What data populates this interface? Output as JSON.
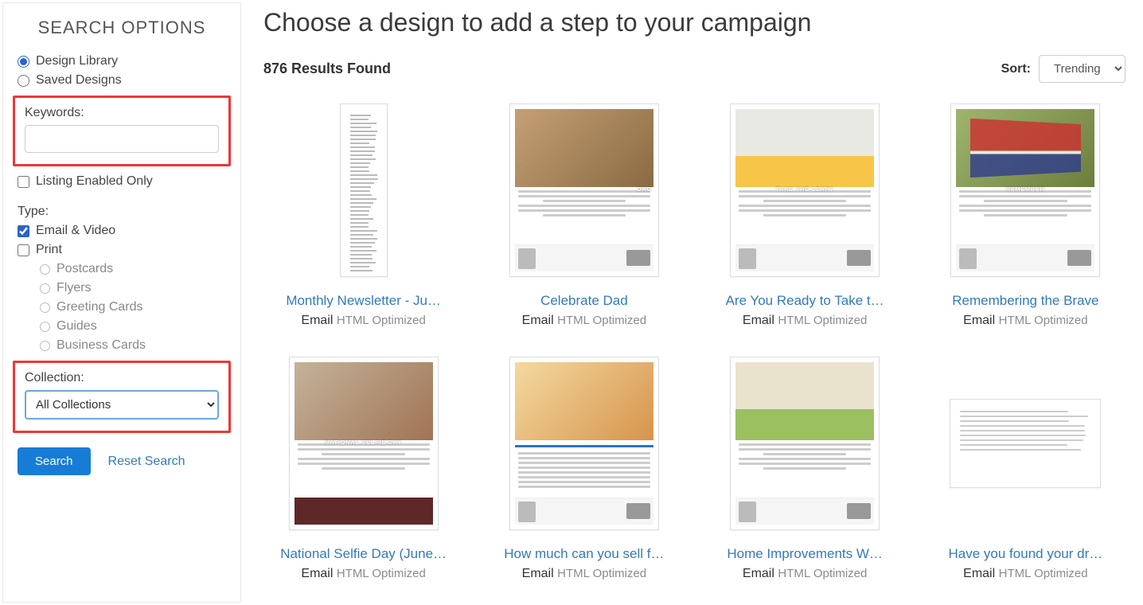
{
  "sidebar": {
    "title": "SEARCH OPTIONS",
    "source_design_library": "Design Library",
    "source_saved_designs": "Saved Designs",
    "keywords_label": "Keywords:",
    "keywords_value": "",
    "listing_enabled_label": "Listing Enabled Only",
    "type_label": "Type:",
    "type_email_video": "Email & Video",
    "type_print": "Print",
    "print_sub": {
      "postcards": "Postcards",
      "flyers": "Flyers",
      "greeting_cards": "Greeting Cards",
      "guides": "Guides",
      "business_cards": "Business Cards"
    },
    "collection_label": "Collection:",
    "collection_value": "All Collections",
    "search_btn": "Search",
    "reset_btn": "Reset Search"
  },
  "main": {
    "title": "Choose a design to add a step to your campaign",
    "results_count": "876 Results Found",
    "sort_label": "Sort:",
    "sort_value": "Trending"
  },
  "cards": [
    {
      "title": "Monthly Newsletter - Ju…",
      "medium": "Email",
      "subtype": "HTML Optimized",
      "thumbStyle": "narrow"
    },
    {
      "title": "Celebrate Dad",
      "medium": "Email",
      "subtype": "HTML Optimized",
      "thumbStyle": "dad"
    },
    {
      "title": "Are You Ready to Take t…",
      "medium": "Email",
      "subtype": "HTML Optimized",
      "thumbStyle": "leap"
    },
    {
      "title": "Remembering the Brave",
      "medium": "Email",
      "subtype": "HTML Optimized",
      "thumbStyle": "flag"
    },
    {
      "title": "National Selfie Day (June…",
      "medium": "Email",
      "subtype": "HTML Optimized",
      "thumbStyle": "selfie"
    },
    {
      "title": "How much can you sell f…",
      "medium": "Email",
      "subtype": "HTML Optimized",
      "thumbStyle": "sell"
    },
    {
      "title": "Home Improvements W…",
      "medium": "Email",
      "subtype": "HTML Optimized",
      "thumbStyle": "home"
    },
    {
      "title": "Have you found your dr…",
      "medium": "Email",
      "subtype": "HTML Optimized",
      "thumbStyle": "wide"
    }
  ]
}
